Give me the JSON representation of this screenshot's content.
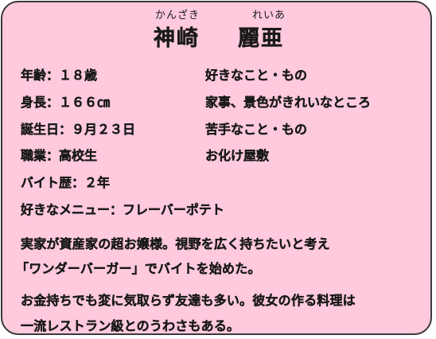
{
  "header": {
    "surname_reading": "かんざき",
    "given_reading": "れいあ",
    "surname": "神崎",
    "given_name": "麗亜"
  },
  "profile": {
    "age": "年齢：１８歳",
    "height": "身長：１６６㎝",
    "birthday": "誕生日：９月２３日",
    "occupation": "職業：高校生",
    "work_years": "バイト歴：２年",
    "favorite_menu": "好きなメニュー：フレーバーポテト"
  },
  "likes": {
    "label": "好きなこと・もの",
    "value": "家事、景色がきれいなところ"
  },
  "dislikes": {
    "label": "苦手なこと・もの",
    "value": "お化け屋敷"
  },
  "description": {
    "line1": "実家が資産家の超お嬢様。視野を広く持ちたいと考え",
    "line2": "「ワンダーバーガー」でバイトを始めた。",
    "line3": "お金持ちでも変に気取らず友達も多い。彼女の作る料理は",
    "line4": "一流レストラン級とのうわさもある。"
  },
  "colors": {
    "card_background": "#ffc9de",
    "border": "#3a3a3a",
    "text": "#1a1a1a"
  }
}
